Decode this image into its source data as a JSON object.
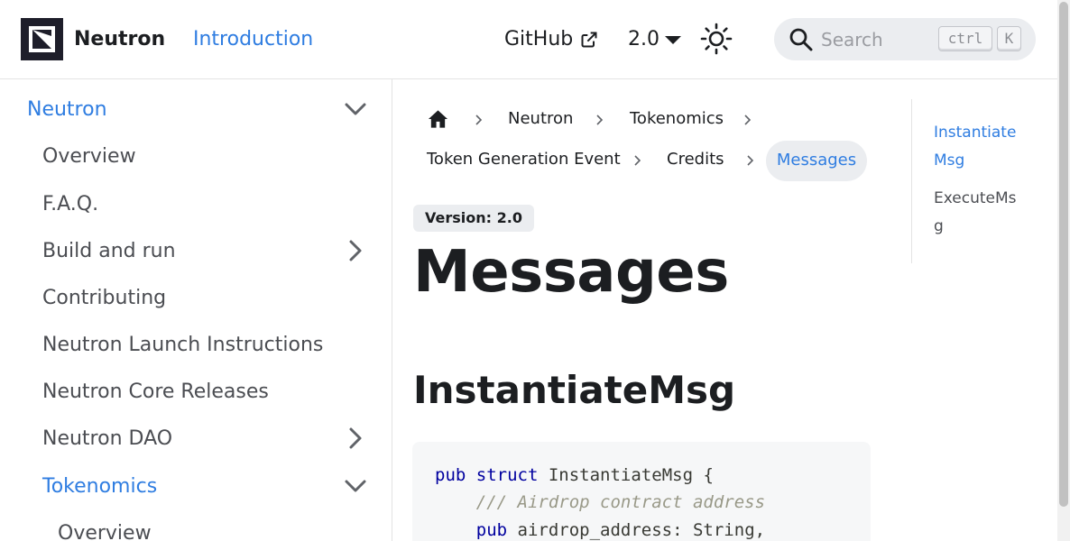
{
  "navbar": {
    "brand": "Neutron",
    "intro_link": "Introduction",
    "github_link": "GitHub",
    "version": "2.0",
    "search_placeholder": "Search",
    "kbd_ctrl": "ctrl",
    "kbd_k": "K"
  },
  "sidebar": {
    "items": [
      {
        "label": "Neutron",
        "level": 0,
        "active": true,
        "chevron": "down"
      },
      {
        "label": "Overview",
        "level": 1
      },
      {
        "label": "F.A.Q.",
        "level": 1
      },
      {
        "label": "Build and run",
        "level": 1,
        "chevron": "right"
      },
      {
        "label": "Contributing",
        "level": 1
      },
      {
        "label": "Neutron Launch Instructions",
        "level": 1
      },
      {
        "label": "Neutron Core Releases",
        "level": 1
      },
      {
        "label": "Neutron DAO",
        "level": 1,
        "chevron": "right"
      },
      {
        "label": "Tokenomics",
        "level": 1,
        "active": true,
        "chevron": "down"
      },
      {
        "label": "Overview",
        "level": 2
      }
    ]
  },
  "breadcrumbs": {
    "items": [
      "Neutron",
      "Tokenomics",
      "Token Generation Event",
      "Credits"
    ],
    "current": "Messages"
  },
  "main": {
    "version_badge": "Version: 2.0",
    "title": "Messages",
    "section_heading": "InstantiateMsg",
    "code": {
      "line1_kw1": "pub",
      "line1_kw2": "struct",
      "line1_rest": " InstantiateMsg {",
      "line2_comment": "/// Airdrop contract address",
      "line3_kw": "pub",
      "line3_rest": " airdrop_address: String,"
    }
  },
  "toc": {
    "items": [
      {
        "label": "InstantiateMsg",
        "active": true
      },
      {
        "label": "ExecuteMsg",
        "active": false
      }
    ]
  },
  "colors": {
    "accent": "#2f7de1",
    "text": "#1c1e21",
    "muted": "#4b4d52",
    "pill_bg": "#ebedf0"
  }
}
